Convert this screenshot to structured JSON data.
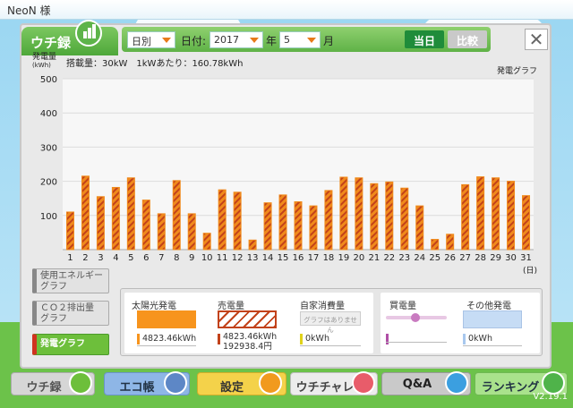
{
  "user": {
    "name": "NeoN 様"
  },
  "header": {
    "tab_label": "ウチ録",
    "period_select": "日別",
    "date_label": "日付:",
    "year_select": "2017",
    "year_suffix": "年",
    "month_select": "5",
    "month_suffix": "月",
    "today_button": "当日",
    "compare_button": "比較",
    "close_label": "✕"
  },
  "chart_info": {
    "unit_label_line1": "発電量",
    "unit_label_line2": "(kWh)",
    "capacity_text": "搭載量：30kW　1kWあたり：160.78kWh",
    "graph_title": "発電グラフ",
    "x_unit": "(日)"
  },
  "chart_data": {
    "type": "bar",
    "categories": [
      "1",
      "2",
      "3",
      "4",
      "5",
      "6",
      "7",
      "8",
      "9",
      "10",
      "11",
      "12",
      "13",
      "14",
      "15",
      "16",
      "17",
      "18",
      "19",
      "20",
      "21",
      "22",
      "23",
      "24",
      "25",
      "26",
      "27",
      "28",
      "29",
      "30",
      "31"
    ],
    "values": [
      110,
      215,
      155,
      182,
      210,
      145,
      105,
      202,
      105,
      48,
      175,
      168,
      28,
      137,
      160,
      140,
      128,
      173,
      212,
      210,
      193,
      198,
      180,
      128,
      30,
      45,
      190,
      213,
      210,
      200,
      158
    ],
    "xlabel": "(日)",
    "ylabel": "発電量 (kWh)",
    "ylim": [
      0,
      500
    ],
    "yticks": [
      100,
      200,
      300,
      400,
      500
    ],
    "colors": {
      "bar_fill": "#f08a1c",
      "bar_stripe": "#c2421a"
    }
  },
  "side_menu": {
    "energy_graph_line1": "使用エネルギー",
    "energy_graph_line2": "グラフ",
    "co2_graph_line1": "ＣＯ２排出量",
    "co2_graph_line2": "グラフ",
    "power_graph": "発電グラフ"
  },
  "legend": {
    "solar_title": "太陽光発電",
    "solar_value": "4823.46kWh",
    "sell_title": "売電量",
    "sell_value": "4823.46kWh",
    "sell_yen": "192938.4円",
    "self_title": "自家消費量",
    "self_note": "グラフはありません",
    "self_value": "0kWh",
    "buy_title": "買電量",
    "other_title": "その他発電",
    "other_value": "0kWh"
  },
  "bottom_nav": {
    "uchiroku": "ウチ録",
    "ecobook": "エコ帳",
    "settings": "設定",
    "uchichalle": "ウチチャレ",
    "qa": "Q&A",
    "ranking": "ランキング",
    "version": "V2.19.1"
  }
}
